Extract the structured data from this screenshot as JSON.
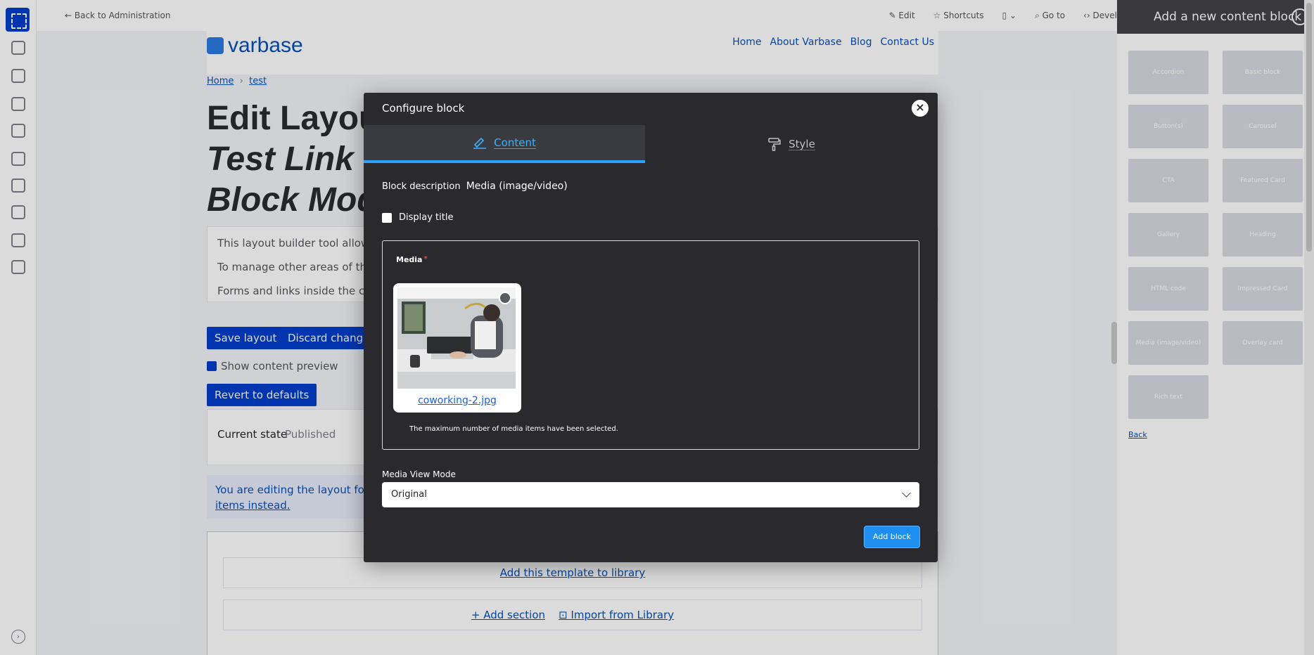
{
  "topbar": {
    "back_label": "← Back to Administration",
    "actions": [
      "✎ Edit",
      "☆ Shortcuts",
      "▯ ⌄",
      "⌕ Go to",
      "‹› Devel"
    ]
  },
  "site": {
    "logo_text": "varbase",
    "nav": [
      "Home",
      "About Varbase",
      "Blog",
      "Contact Us"
    ]
  },
  "breadcrumb": {
    "home": "Home",
    "sep": "›",
    "current": "test"
  },
  "page": {
    "title_line1": "Edit Layout f",
    "title_line2": "Test Link Fi",
    "title_line3": "Block Moda"
  },
  "info": {
    "line1": "This layout builder tool allows y",
    "line2": "To manage other areas of the p",
    "line3": "Forms and links inside the cont"
  },
  "buttons": {
    "save_layout": "Save layout",
    "discard_changes": "Discard changes",
    "revert": "Revert to defaults"
  },
  "preview": {
    "label": "Show content preview"
  },
  "state": {
    "label": "Current state",
    "value": "Published"
  },
  "notice": {
    "line1": "You are editing the layout for th",
    "line2": "items instead."
  },
  "layout_builder": {
    "template_link": "Add this template to library",
    "add_section": "+ Add section",
    "import": "⊡ Import from Library"
  },
  "offcanvas": {
    "title": "Add a new content block",
    "items": [
      "Accordion",
      "Basic block",
      "Button(s)",
      "Carousel",
      "CTA",
      "Featured Card",
      "Gallery",
      "Heading",
      "HTML code",
      "Impressed Card",
      "Media (image/video)",
      "Overlay card",
      "Rich text"
    ],
    "back": "Back"
  },
  "dialog": {
    "title": "Configure block",
    "close_glyph": "×",
    "tabs": {
      "content": "Content",
      "style": "Style"
    },
    "block_description_label": "Block description",
    "block_description_value": "Media (image/video)",
    "display_title_label": "Display title",
    "media_label": "Media",
    "required_marker": "*",
    "media_filename": "coworking-2.jpg",
    "media_max_text": "The maximum number of media items have been selected.",
    "view_mode_label": "Media View Mode",
    "view_mode_value": "Original",
    "add_block_label": "Add block"
  },
  "colors": {
    "dialog_bg": "#2a2a2e",
    "active_tab": "#2aa3ff",
    "primary_button": "#1f8ef1",
    "gin_blue": "#003ecc"
  },
  "icons": {
    "dialog_close": "close-icon",
    "content_tab": "pen-icon",
    "style_tab": "paint-roller-icon",
    "media_remove": "remove-icon",
    "select_arrow": "chevron-down-icon"
  }
}
